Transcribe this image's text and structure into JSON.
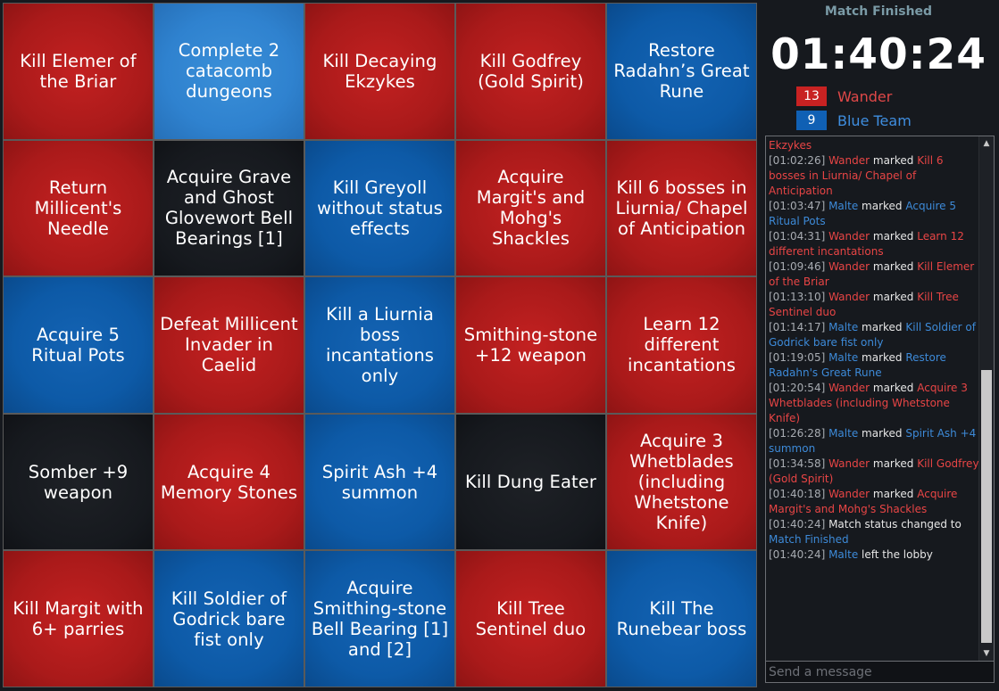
{
  "board": {
    "cells": [
      {
        "label": "Kill Elemer of the Briar",
        "color": "red"
      },
      {
        "label": "Complete 2 catacomb dungeons",
        "color": "lblue"
      },
      {
        "label": "Kill Decaying Ekzykes",
        "color": "red"
      },
      {
        "label": "Kill Godfrey (Gold Spirit)",
        "color": "red"
      },
      {
        "label": "Restore Radahn’s Great Rune",
        "color": "blue"
      },
      {
        "label": "Return Millicent's Needle",
        "color": "red"
      },
      {
        "label": "Acquire Grave and Ghost Glovewort Bell Bearings [1]",
        "color": "black"
      },
      {
        "label": "Kill Greyoll without status effects",
        "color": "blue"
      },
      {
        "label": "Acquire Margit's and Mohg's Shackles",
        "color": "red"
      },
      {
        "label": "Kill 6 bosses in Liurnia/ Chapel of Anticipation",
        "color": "red"
      },
      {
        "label": "Acquire 5 Ritual Pots",
        "color": "blue"
      },
      {
        "label": "Defeat Millicent Invader in Caelid",
        "color": "red"
      },
      {
        "label": "Kill a Liurnia boss incantations only",
        "color": "blue"
      },
      {
        "label": "Smithing-stone +12 weapon",
        "color": "red"
      },
      {
        "label": "Learn 12 different incantations",
        "color": "red"
      },
      {
        "label": "Somber +9 weapon",
        "color": "black"
      },
      {
        "label": "Acquire 4 Memory Stones",
        "color": "red"
      },
      {
        "label": "Spirit Ash +4 summon",
        "color": "blue"
      },
      {
        "label": "Kill Dung Eater",
        "color": "black"
      },
      {
        "label": "Acquire 3 Whetblades (including Whetstone Knife)",
        "color": "red"
      },
      {
        "label": "Kill Margit with 6+ parries",
        "color": "red"
      },
      {
        "label": "Kill Soldier of Godrick bare fist only",
        "color": "blue"
      },
      {
        "label": "Acquire Smithing-stone Bell Bearing [1] and [2]",
        "color": "blue"
      },
      {
        "label": "Kill Tree Sentinel duo",
        "color": "red"
      },
      {
        "label": "Kill The Runebear boss",
        "color": "blue"
      }
    ]
  },
  "match": {
    "status": "Match Finished",
    "timer": "01:40:24"
  },
  "teams": {
    "red": {
      "score": "13",
      "name": "Wander",
      "color": "#c82222"
    },
    "blue": {
      "score": "9",
      "name": "Blue Team",
      "color": "#1060b4"
    }
  },
  "chat": {
    "placeholder": "Send a message",
    "entries": [
      [
        {
          "t": "Ekzykes",
          "c": "r"
        }
      ],
      [
        {
          "t": "[01:02:26] ",
          "c": "ts"
        },
        {
          "t": "Wander",
          "c": "r"
        },
        {
          "t": " marked ",
          "c": "w"
        },
        {
          "t": "Kill 6 bosses in Liurnia/ Chapel of Anticipation",
          "c": "r"
        }
      ],
      [
        {
          "t": "[01:03:47] ",
          "c": "ts"
        },
        {
          "t": "Malte",
          "c": "b"
        },
        {
          "t": " marked ",
          "c": "w"
        },
        {
          "t": "Acquire 5 Ritual Pots",
          "c": "b"
        }
      ],
      [
        {
          "t": "[01:04:31] ",
          "c": "ts"
        },
        {
          "t": "Wander",
          "c": "r"
        },
        {
          "t": " marked ",
          "c": "w"
        },
        {
          "t": "Learn 12 different incantations",
          "c": "r"
        }
      ],
      [
        {
          "t": "[01:09:46] ",
          "c": "ts"
        },
        {
          "t": "Wander",
          "c": "r"
        },
        {
          "t": " marked ",
          "c": "w"
        },
        {
          "t": "Kill Elemer of the Briar",
          "c": "r"
        }
      ],
      [
        {
          "t": "[01:13:10] ",
          "c": "ts"
        },
        {
          "t": "Wander",
          "c": "r"
        },
        {
          "t": " marked ",
          "c": "w"
        },
        {
          "t": "Kill Tree Sentinel duo",
          "c": "r"
        }
      ],
      [
        {
          "t": "[01:14:17] ",
          "c": "ts"
        },
        {
          "t": "Malte",
          "c": "b"
        },
        {
          "t": " marked ",
          "c": "w"
        },
        {
          "t": "Kill Soldier of Godrick bare fist only",
          "c": "b"
        }
      ],
      [
        {
          "t": "[01:19:05] ",
          "c": "ts"
        },
        {
          "t": "Malte",
          "c": "b"
        },
        {
          "t": " marked ",
          "c": "w"
        },
        {
          "t": "Restore Radahn's Great Rune",
          "c": "b"
        }
      ],
      [
        {
          "t": "[01:20:54] ",
          "c": "ts"
        },
        {
          "t": "Wander",
          "c": "r"
        },
        {
          "t": " marked ",
          "c": "w"
        },
        {
          "t": "Acquire 3 Whetblades (including Whetstone Knife)",
          "c": "r"
        }
      ],
      [
        {
          "t": "[01:26:28] ",
          "c": "ts"
        },
        {
          "t": "Malte",
          "c": "b"
        },
        {
          "t": " marked ",
          "c": "w"
        },
        {
          "t": "Spirit Ash +4 summon",
          "c": "b"
        }
      ],
      [
        {
          "t": "[01:34:58] ",
          "c": "ts"
        },
        {
          "t": "Wander",
          "c": "r"
        },
        {
          "t": " marked ",
          "c": "w"
        },
        {
          "t": "Kill Godfrey (Gold Spirit)",
          "c": "r"
        }
      ],
      [
        {
          "t": "[01:40:18] ",
          "c": "ts"
        },
        {
          "t": "Wander",
          "c": "r"
        },
        {
          "t": " marked ",
          "c": "w"
        },
        {
          "t": "Acquire Margit's and Mohg's Shackles",
          "c": "r"
        }
      ],
      [
        {
          "t": "[01:40:24] ",
          "c": "ts"
        },
        {
          "t": "Match status changed to ",
          "c": "w"
        },
        {
          "t": "Match Finished",
          "c": "b"
        }
      ],
      [
        {
          "t": "[01:40:24] ",
          "c": "ts"
        },
        {
          "t": "Malte",
          "c": "b"
        },
        {
          "t": " left the lobby",
          "c": "w"
        }
      ]
    ]
  },
  "icons": {
    "scroll_up": "triangle-up-icon",
    "scroll_down": "triangle-down-icon"
  }
}
